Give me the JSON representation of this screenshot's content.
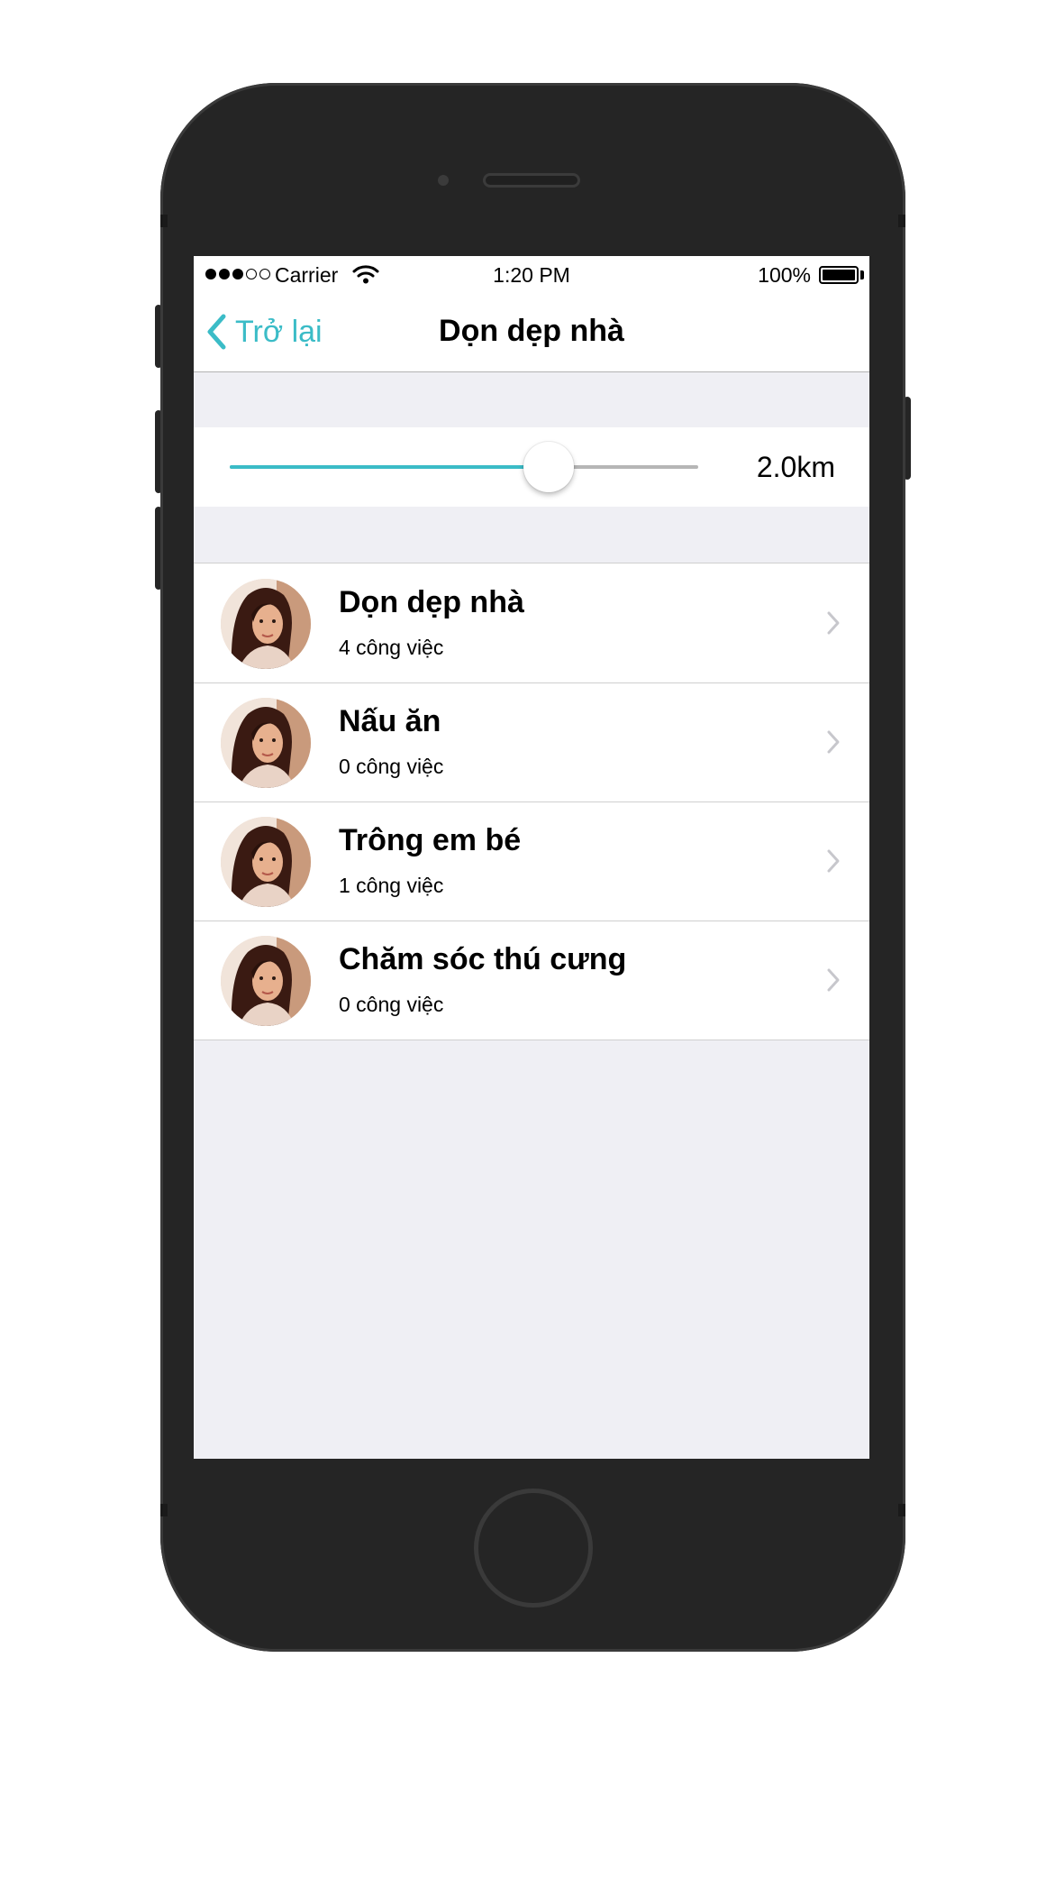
{
  "status_bar": {
    "carrier": "Carrier",
    "time": "1:20 PM",
    "battery": "100%",
    "signal_bars_filled": 3,
    "signal_bars_total": 5
  },
  "navbar": {
    "back_label": "Trở lại",
    "title": "Dọn dẹp nhà"
  },
  "slider": {
    "value_label": "2.0km",
    "fraction": 0.68
  },
  "categories": [
    {
      "title": "Dọn dẹp nhà",
      "subtitle": "4 công việc"
    },
    {
      "title": "Nấu ăn",
      "subtitle": "0 công việc"
    },
    {
      "title": "Trông em bé",
      "subtitle": "1 công việc"
    },
    {
      "title": "Chăm sóc thú cưng",
      "subtitle": "0 công việc"
    }
  ],
  "colors": {
    "accent": "#3bbcc7",
    "background": "#efeff4",
    "phone_body": "#252525"
  },
  "icons": {
    "back": "chevron-left-icon",
    "row_disclosure": "chevron-right-icon",
    "wifi": "wifi-icon",
    "battery": "battery-icon"
  }
}
